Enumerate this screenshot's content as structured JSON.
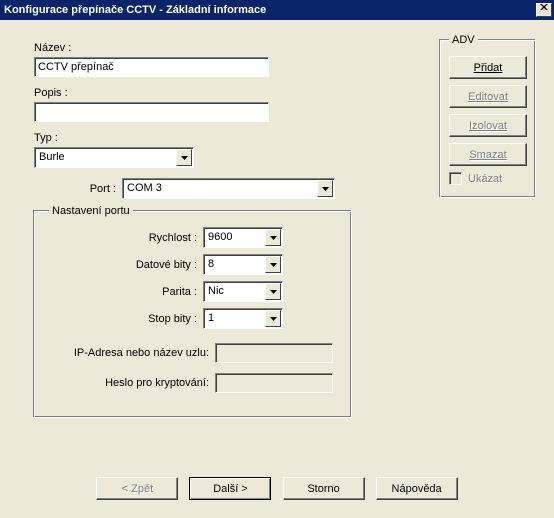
{
  "title": "Konfigurace přepínače CCTV - Základní informace",
  "form": {
    "name_label": "Název :",
    "name_value": "CCTV přepínač",
    "desc_label": "Popis :",
    "desc_value": "",
    "type_label": "Typ :",
    "type_value": "Burle",
    "port_label": "Port :",
    "port_value": "COM 3"
  },
  "port_group": {
    "legend": "Nastavení portu",
    "speed_label": "Rychlost :",
    "speed_value": "9600",
    "databits_label": "Datové bity :",
    "databits_value": "8",
    "parity_label": "Parita :",
    "parity_value": "Nic",
    "stopbits_label": "Stop bity :",
    "stopbits_value": "1",
    "ip_label": "IP-Adresa nebo název uzlu:",
    "pass_label": "Heslo pro kryptování:"
  },
  "adv": {
    "legend": "ADV",
    "add": "Přidat",
    "edit": "Editovat",
    "isolate": "Izolovat",
    "delete": "Smazat",
    "show": "Ukázat"
  },
  "buttons": {
    "back": "< Zpět",
    "next": "Další >",
    "cancel": "Storno",
    "help": "Nápověda"
  }
}
